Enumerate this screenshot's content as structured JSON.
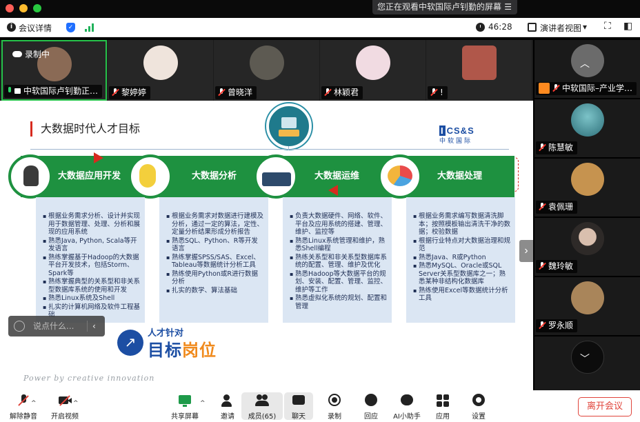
{
  "window": {
    "watching_banner": "您正在观看中软国际卢钊勤的屏幕",
    "menu_glyph": "☰"
  },
  "infobar": {
    "meeting_details": "会议详情",
    "info_glyph": "i",
    "shield_glyph": "✓",
    "timer": "46:28",
    "view_mode": "演讲者视图",
    "view_caret": "▾",
    "fullscreen_glyph": "⛶",
    "layout_glyph": "◧"
  },
  "participants": [
    {
      "name": "中软国际卢钊勤正…",
      "mic": "on",
      "recording": "录制中",
      "avatar_color": "#8a6a55"
    },
    {
      "name": "黎婷婷",
      "mic": "off",
      "avatar_color": "#efe4dc"
    },
    {
      "name": "曾晓洋",
      "mic": "off",
      "avatar_color": "#5d5a52"
    },
    {
      "name": "林颖君",
      "mic": "off",
      "avatar_color": "#f1dbe2"
    },
    {
      "name": "!",
      "mic": "off",
      "avatar_color": "#b0574a"
    }
  ],
  "gallery": [
    {
      "name": "中软国际–产业学…",
      "mic": "off",
      "org": true,
      "avatar_color": "#6b6b6b"
    },
    {
      "name": "陈慧敏",
      "mic": "off",
      "avatar_color": "#4aa0a8"
    },
    {
      "name": "袁佩珊",
      "mic": "off",
      "avatar_color": "#c6934f"
    },
    {
      "name": "魏玲敏",
      "mic": "off",
      "avatar_color": "#2e2a28"
    },
    {
      "name": "罗永顺",
      "mic": "off",
      "avatar_color": "#a9855a"
    },
    {
      "name": "",
      "mic": "off",
      "avatar_color": "#1a1a1a"
    }
  ],
  "slide": {
    "title": "大数据时代人才目标",
    "logo_top": "CS&S",
    "logo_mark": "I",
    "logo_bottom": "中软国际",
    "columns": [
      {
        "heading": "大数据应用开发",
        "items": [
          "根据业务需求分析、设计并实现用于数据管理、处理、分析和展现的应用系统",
          "熟悉Java, Python, Scala等开发语言",
          "熟练掌握基于Hadoop的大数据平台开发技术，包括Storm、Spark等",
          "熟练掌握典型的关系型和非关系型数据库系统的使用和开发",
          "熟悉Linux系统及Shell",
          "扎实的计算机网络及软件工程基础"
        ]
      },
      {
        "heading": "大数据分析",
        "items": [
          "根据业务需求对数据进行建模及分析，通过一定的算法，定性、定量分析结果形成分析报告",
          "熟悉SQL、Python、R等开发语言",
          "熟练掌握SPSS/SAS、Excel、Tableau等数据统计分析工具",
          "熟练使用Python或R进行数据分析",
          "扎实的数学、算法基础"
        ]
      },
      {
        "heading": "大数据运维",
        "items": [
          "负责大数据硬件、网络、软件、平台及应用系统的搭建、管理、维护、监控等",
          "熟悉Linux系统管理和维护，熟悉Shell编程",
          "熟练关系型和非关系型数据库系统的配置、管理、维护及优化",
          "熟悉Hadoop等大数据平台的规划、安装、配置、管理、监控、维护等工作",
          "熟悉虚拟化系统的规划、配置和管理"
        ]
      },
      {
        "heading": "大数据处理",
        "items": [
          "根据业务需求编写数据清洗脚本；按照模板输出清洗干净的数据；校验数据",
          "根据行业特点对大数据治理和规范",
          "熟悉Java、R或Python",
          "熟悉MySQL、Oracle或SQL Server关系型数据库之一；熟悉某种非结构化数据库",
          "熟练使用Excel等数据统计分析工具"
        ]
      }
    ],
    "target_small": "人才针对",
    "target_big_a": "目标",
    "target_big_b": "岗位",
    "target_glyph": "↗",
    "power_line": "Power by creative innovation",
    "next_glyph": "›"
  },
  "chat": {
    "placeholder": "说点什么...",
    "chevron": "‹"
  },
  "toolbar": {
    "unmute": "解除静音",
    "start_video": "开启视频",
    "share_screen": "共享屏幕",
    "invite": "邀请",
    "members": "成员(65)",
    "chat": "聊天",
    "record": "录制",
    "reply": "回应",
    "ai_assistant": "AI小助手",
    "apps": "应用",
    "settings": "设置",
    "leave": "离开会议",
    "caret": "^"
  },
  "colors": {
    "band_green": "#1e9140",
    "card_blue": "#dbe6f3",
    "accent_red": "#d72b1f",
    "brand_blue": "#1c4ea3",
    "leave_red": "#e0433a"
  }
}
